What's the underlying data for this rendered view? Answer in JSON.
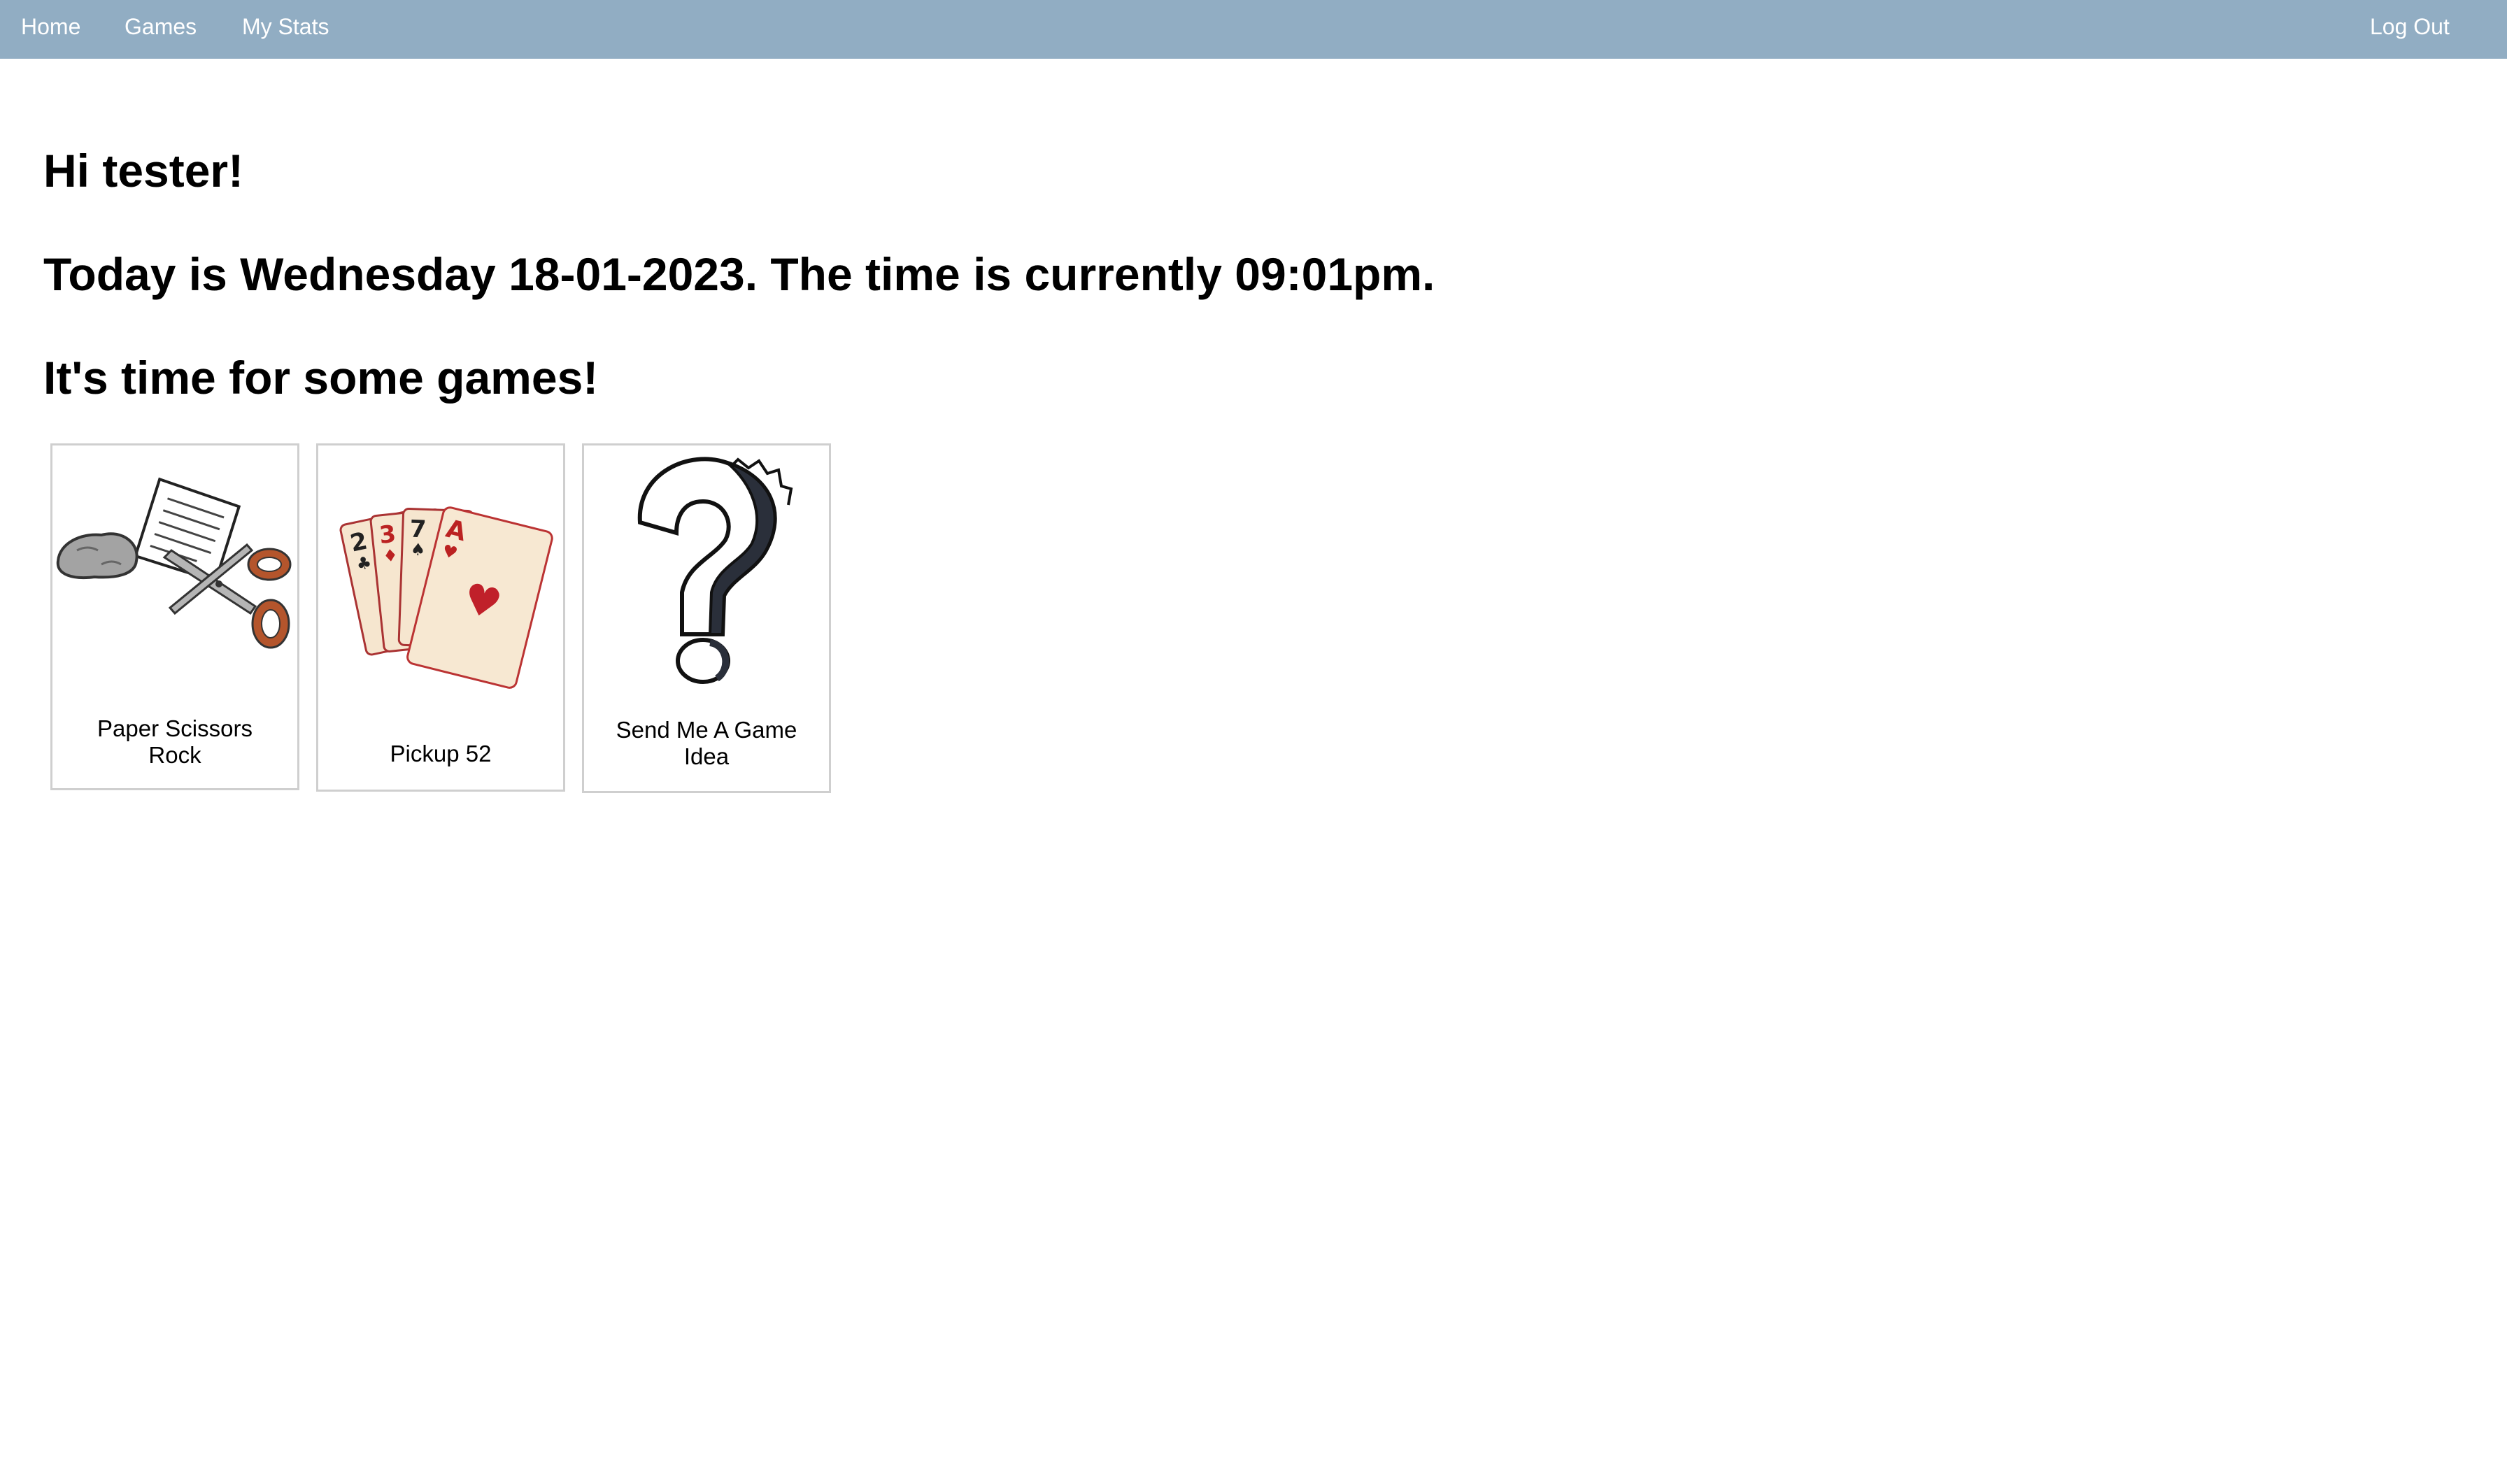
{
  "nav": {
    "home": "Home",
    "games": "Games",
    "stats": "My Stats",
    "logout": "Log Out"
  },
  "main": {
    "greeting": "Hi tester!",
    "date_line": "Today is Wednesday 18-01-2023. The time is currently 09:01pm.",
    "games_heading": "It's time for some games!"
  },
  "games": [
    {
      "label": "Paper Scissors Rock",
      "icon": "rock-paper-scissors-icon"
    },
    {
      "label": "Pickup 52",
      "icon": "playing-cards-icon"
    },
    {
      "label": "Send Me A Game Idea",
      "icon": "question-mark-icon"
    }
  ],
  "colors": {
    "navbar": "#91adc3",
    "nav_text": "#ffffff",
    "card_border": "#cfcfcf"
  }
}
